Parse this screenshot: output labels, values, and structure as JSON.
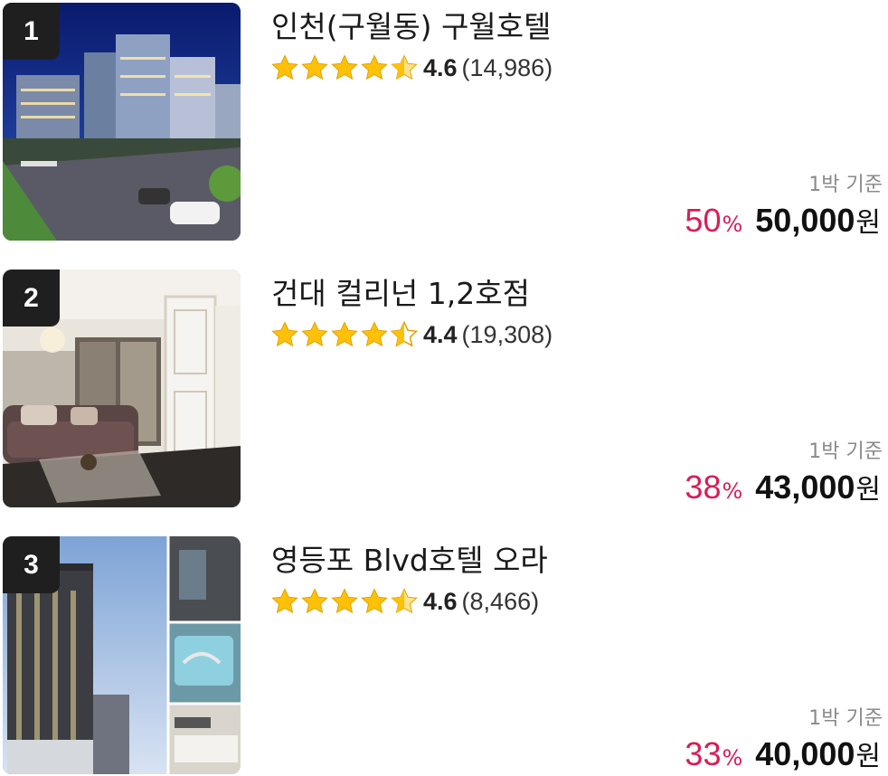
{
  "colors": {
    "discount": "#d81d59",
    "star": "#ffc107",
    "rank_badge": "#1f1f1f"
  },
  "icons": {
    "star": "star-icon",
    "half_star": "star-half-icon",
    "empty_star": "star-empty-icon"
  },
  "items": [
    {
      "rank": "1",
      "name": "인천(구월동) 구월호텔",
      "stars": [
        "full",
        "full",
        "full",
        "full",
        "half"
      ],
      "rating": "4.6",
      "reviews": "(14,986)",
      "basis": "1박 기준",
      "discount": "50",
      "percent_sign": "%",
      "price": "50,000",
      "currency": "원"
    },
    {
      "rank": "2",
      "name": "건대 컬리넌 1,2호점",
      "stars": [
        "full",
        "full",
        "full",
        "full",
        "half-empty"
      ],
      "rating": "4.4",
      "reviews": "(19,308)",
      "basis": "1박 기준",
      "discount": "38",
      "percent_sign": "%",
      "price": "43,000",
      "currency": "원"
    },
    {
      "rank": "3",
      "name": "영등포 Blvd호텔 오라",
      "stars": [
        "full",
        "full",
        "full",
        "full",
        "half"
      ],
      "rating": "4.6",
      "reviews": "(8,466)",
      "basis": "1박 기준",
      "discount": "33",
      "percent_sign": "%",
      "price": "40,000",
      "currency": "원"
    }
  ]
}
